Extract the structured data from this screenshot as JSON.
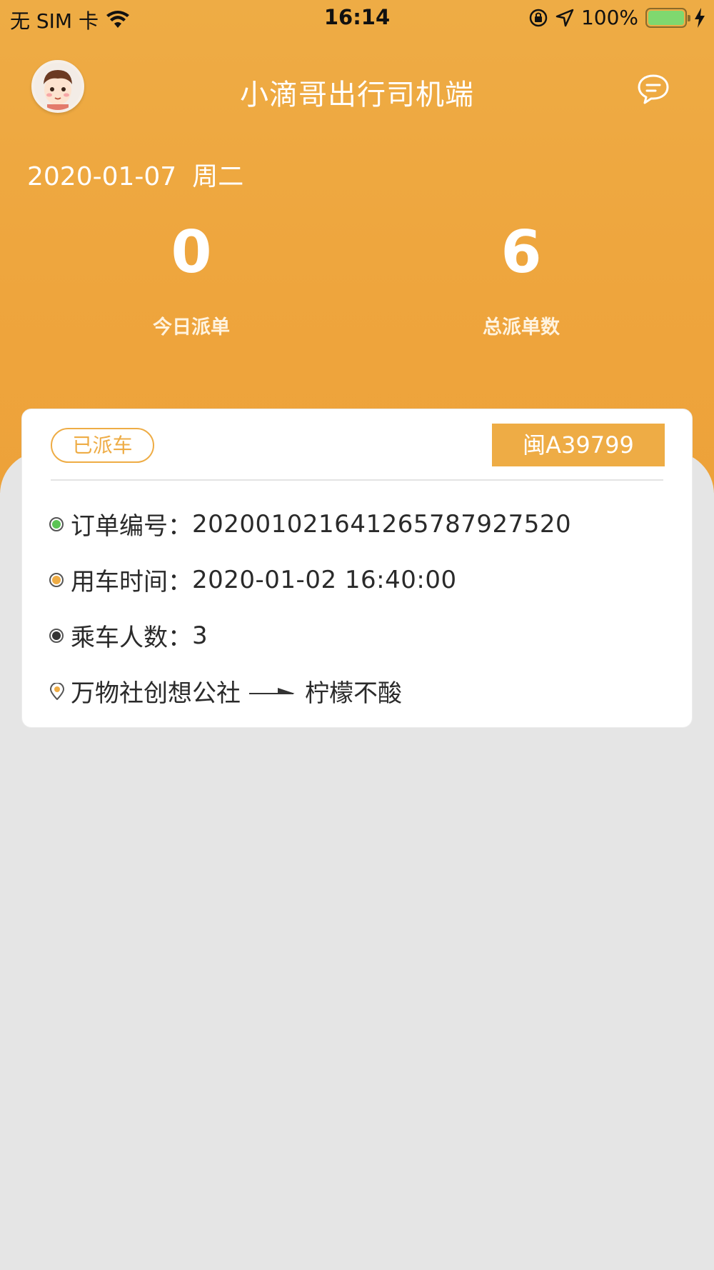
{
  "status_bar": {
    "carrier": "无 SIM 卡",
    "time": "16:14",
    "battery_percent": "100%",
    "battery_level": 1.0,
    "battery_color": "#7fd86f"
  },
  "header": {
    "title": "小滴哥出行司机端",
    "date": "2020-01-07",
    "weekday": "周二",
    "accent_color": "#eeac45"
  },
  "stats": [
    {
      "value": "0",
      "label": "今日派单"
    },
    {
      "value": "6",
      "label": "总派单数"
    }
  ],
  "order_card": {
    "status": "已派车",
    "plate": "闽A39799",
    "order_no_label": "订单编号：",
    "order_no": "20200102164126578792752​0",
    "time_label": "用车时间：",
    "time": "2020-01-02 16:40:00",
    "passengers_label": "乘车人数：",
    "passengers": "3",
    "from": "万物社创想公社",
    "to": "柠檬不酸"
  }
}
